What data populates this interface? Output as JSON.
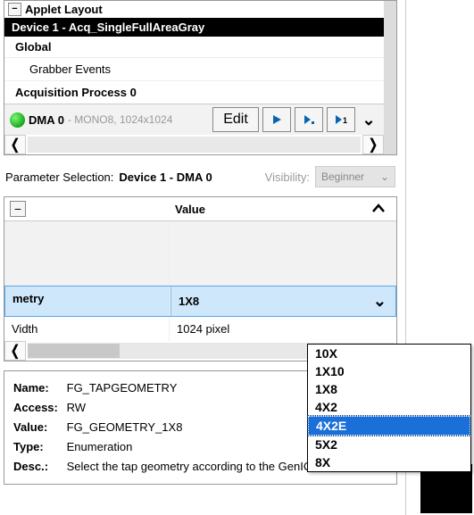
{
  "tree": {
    "header": "Applet Layout",
    "device": "Device 1 - Acq_SingleFullAreaGray",
    "global": "Global",
    "grabber": "Grabber Events",
    "acq": "Acquisition Process 0",
    "dma_label": "DMA 0",
    "dma_sub": " - MONO8, 1024x1024",
    "edit": "Edit"
  },
  "param": {
    "sel_label": "Parameter Selection:",
    "sel_value": "Device 1 - DMA 0",
    "vis_label": "Visibility:",
    "vis_value": "Beginner"
  },
  "grid": {
    "value_header": "Value",
    "row_sel_name": "metry",
    "row_sel_value": "1X8",
    "row_width_name": "Vidth",
    "row_width_value": "1024 pixel"
  },
  "dropdown": {
    "options": [
      "10X",
      "1X10",
      "1X8",
      "4X2",
      "4X2E",
      "5X2",
      "8X"
    ],
    "selected": "4X2E"
  },
  "detail": {
    "name_k": "Name:",
    "name_v": "FG_TAPGEOMETRY",
    "access_k": "Access:",
    "access_v": "RW",
    "value_k": "Value:",
    "value_v": "FG_GEOMETRY_1X8",
    "type_k": "Type:",
    "type_v": "Enumeration",
    "desc_k": "Desc.:",
    "desc_v": "Select the tap geometry according to the GenICam SFNC."
  }
}
